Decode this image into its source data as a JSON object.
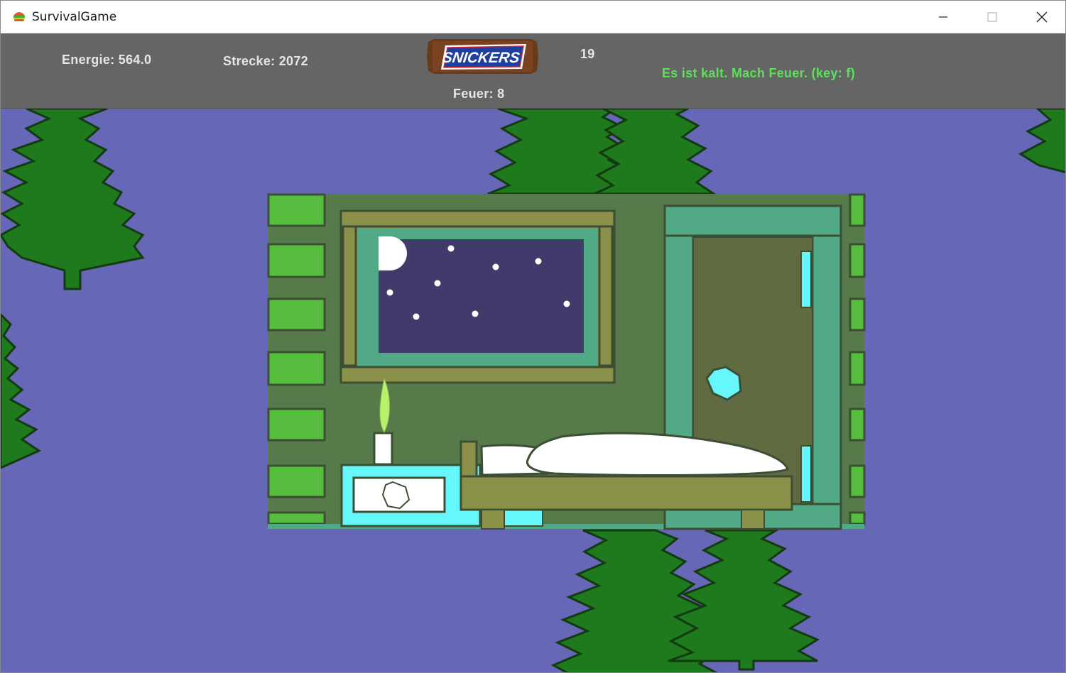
{
  "window": {
    "title": "SurvivalGame",
    "buttons": {
      "minimize": "minimize",
      "maximize": "maximize",
      "close": "close"
    }
  },
  "hud": {
    "energie": "Energie: 564.0",
    "strecke": "Strecke: 2072",
    "counter": "19",
    "feuer": "Feuer: 8",
    "message": "Es ist kalt. Mach Feuer. (key: f)",
    "item_logo": "SNICKERS"
  },
  "colors": {
    "sky": "#6667b6",
    "hud_background": "#656565",
    "message_text": "#5be05b",
    "tree": "#1e7a1c",
    "cabin_wall": "#577a4a",
    "log_green": "#56bd3f",
    "frame_olive": "#8b9148",
    "night_sky": "#413b6c",
    "door_teal": "#52a985",
    "cyan": "#66f7fd"
  },
  "icons": {
    "app": "burger-icon",
    "minimize": "minimize-icon",
    "maximize": "maximize-icon",
    "close": "close-icon"
  }
}
